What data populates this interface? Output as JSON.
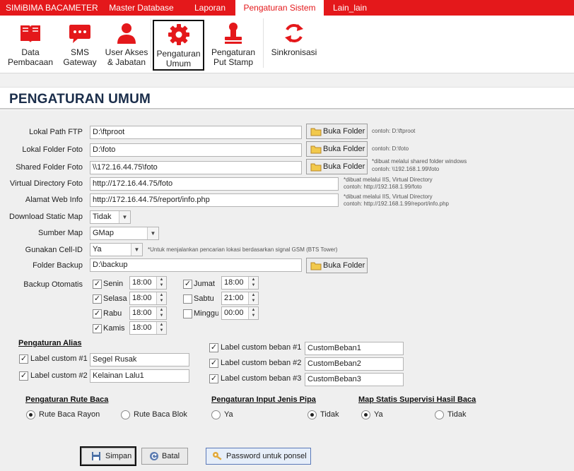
{
  "app": {
    "title": "SIMiBIMA BACAMETER"
  },
  "menu": {
    "tabs": [
      "Master Database",
      "Laporan",
      "Pengaturan Sistem",
      "Lain_lain"
    ],
    "active": "Pengaturan Sistem"
  },
  "ribbon": {
    "buttons": [
      {
        "line1": "Data",
        "line2": "Pembacaan",
        "icon": "book-icon"
      },
      {
        "line1": "SMS",
        "line2": "Gateway",
        "icon": "sms-icon"
      },
      {
        "line1": "User Akses",
        "line2": "& Jabatan",
        "icon": "user-icon"
      },
      {
        "line1": "Pengaturan",
        "line2": "Umum",
        "icon": "gear-icon"
      },
      {
        "line1": "Pengaturan",
        "line2": "Put Stamp",
        "icon": "stamp-icon"
      },
      {
        "line1": "Sinkronisasi",
        "line2": "",
        "icon": "sync-icon"
      }
    ]
  },
  "page": {
    "title": "PENGATURAN UMUM"
  },
  "colors": {
    "accent": "#e4181b",
    "title": "#1a2d4a"
  },
  "form": {
    "lokal_path_ftp": {
      "label": "Lokal Path FTP",
      "value": "D:\\ftproot",
      "button": "Buka Folder",
      "note1": "contoh: D:\\ftproot"
    },
    "lokal_folder_foto": {
      "label": "Lokal Folder Foto",
      "value": "D:\\foto",
      "button": "Buka Folder",
      "note1": "contoh: D:\\foto"
    },
    "shared_folder_foto": {
      "label": "Shared Folder Foto",
      "value": "\\\\172.16.44.75\\foto",
      "button": "Buka Folder",
      "note1": "*dibuat melalui shared folder windows",
      "note2": "contoh: \\\\192.168.1.99\\foto"
    },
    "virtual_directory_foto": {
      "label": "Virtual Directory Foto",
      "value": "http://172.16.44.75/foto",
      "note1": "*dibuat melalui IIS, Virtual Directory",
      "note2": "contoh: http://192.168.1.99/foto"
    },
    "alamat_web_info": {
      "label": "Alamat Web Info",
      "value": "http://172.16.44.75/report/info.php",
      "note1": "*dibuat melalui IIS, Virtual Directory",
      "note2": "contoh: http://192.168.1.99/report/info.php"
    },
    "download_static_map": {
      "label": "Download Static Map",
      "value": "Tidak"
    },
    "sumber_map": {
      "label": "Sumber Map",
      "value": "GMap"
    },
    "gunakan_cell_id": {
      "label": "Gunakan Cell-ID",
      "value": "Ya",
      "note1": "*Untuk menjalankan pencarian lokasi berdasarkan signal GSM (BTS Tower)"
    },
    "folder_backup": {
      "label": "Folder Backup",
      "value": "D:\\backup",
      "button": "Buka Folder"
    },
    "backup_otomatis": {
      "label": "Backup Otomatis",
      "days": [
        {
          "name": "Senin",
          "checked": true,
          "time": "18:00"
        },
        {
          "name": "Selasa",
          "checked": true,
          "time": "18:00"
        },
        {
          "name": "Rabu",
          "checked": true,
          "time": "18:00"
        },
        {
          "name": "Kamis",
          "checked": true,
          "time": "18:00"
        },
        {
          "name": "Jumat",
          "checked": true,
          "time": "18:00"
        },
        {
          "name": "Sabtu",
          "checked": false,
          "time": "21:00"
        },
        {
          "name": "Minggu",
          "checked": false,
          "time": "00:00"
        }
      ]
    }
  },
  "alias": {
    "heading": "Pengaturan Alias",
    "left": [
      {
        "label": "Label custom #1",
        "checked": true,
        "value": "Segel Rusak"
      },
      {
        "label": "Label custom #2",
        "checked": true,
        "value": "Kelainan Lalu1"
      }
    ],
    "right": [
      {
        "label": "Label custom beban #1",
        "checked": true,
        "value": "CustomBeban1"
      },
      {
        "label": "Label custom beban #2",
        "checked": true,
        "value": "CustomBeban2"
      },
      {
        "label": "Label custom beban #3",
        "checked": true,
        "value": "CustomBeban3"
      }
    ]
  },
  "rute": {
    "heading": "Pengaturan Rute Baca",
    "options": [
      "Rute Baca Rayon",
      "Rute Baca Blok"
    ],
    "selected": "Rute Baca Rayon"
  },
  "input_pipa": {
    "heading": "Pengaturan Input Jenis Pipa",
    "options": [
      "Ya",
      "Tidak"
    ],
    "selected": "Tidak"
  },
  "map_statis": {
    "heading": "Map Statis Supervisi Hasil Baca",
    "options": [
      "Ya",
      "Tidak"
    ],
    "selected": "Ya"
  },
  "footer": {
    "save": "Simpan",
    "cancel": "Batal",
    "password": "Password untuk ponsel"
  }
}
